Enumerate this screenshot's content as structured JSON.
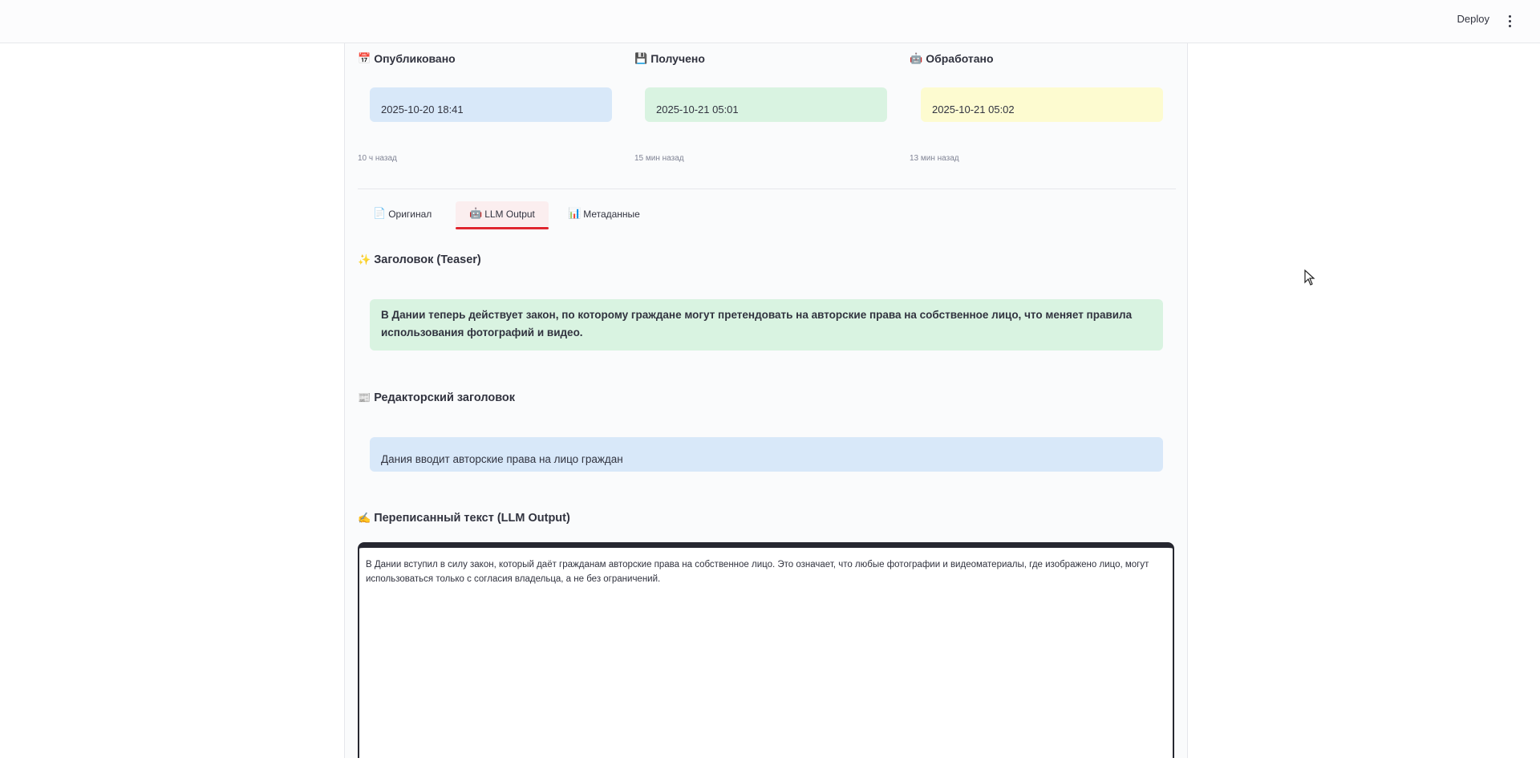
{
  "header": {
    "deploy_label": "Deploy",
    "menu_icon": "more-vert-icon"
  },
  "timestamps": {
    "published": {
      "icon": "📅",
      "label": "Опубликовано",
      "value": "2025-10-20 18:41",
      "ago": "10 ч назад",
      "color": "#d8e8f9"
    },
    "received": {
      "icon": "💾",
      "label": "Получено",
      "value": "2025-10-21 05:01",
      "ago": "15 мин назад",
      "color": "#d9f3e1"
    },
    "processed": {
      "icon": "🤖",
      "label": "Обработано",
      "value": "2025-10-21 05:02",
      "ago": "13 мин назад",
      "color": "#fdfbd0"
    }
  },
  "tabs": [
    {
      "icon": "📄",
      "label": "Оригинал",
      "active": false
    },
    {
      "icon": "🤖",
      "label": "LLM Output",
      "active": true
    },
    {
      "icon": "📊",
      "label": "Метаданные",
      "active": false
    }
  ],
  "teaser": {
    "icon": "✨",
    "title": "Заголовок (Teaser)",
    "text": "В Дании теперь действует закон, по которому граждане могут претендовать на авторские права на собственное лицо, что меняет правила использования фотографий и видео.",
    "color": "#d9f3e1"
  },
  "editorial": {
    "icon": "📰",
    "title": "Редакторский заголовок",
    "text": "Дания вводит авторские права на лицо граждан",
    "color": "#d8e8f9"
  },
  "rewritten": {
    "icon": "✍️",
    "title": "Переписанный текст (LLM Output)",
    "text": "В Дании вступил в силу закон, который даёт гражданам авторские права на собственное лицо. Это означает, что любые фотографии и видеоматериалы, где изображено лицо, могут использоваться только с согласия владельца, а не без ограничений."
  },
  "colors": {
    "accent": "#e0262f",
    "textarea_border": "#262730"
  }
}
